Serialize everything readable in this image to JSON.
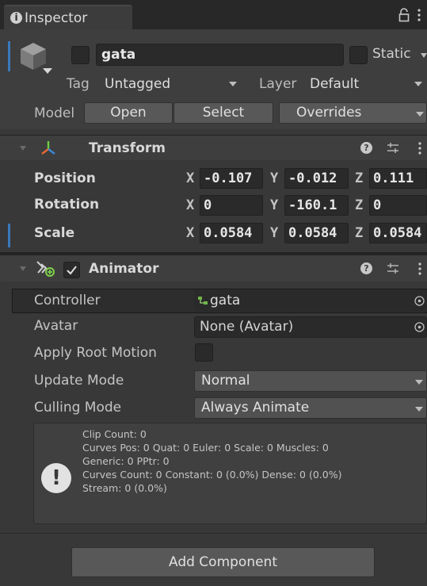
{
  "tab": {
    "icon": "info-icon",
    "label": "Inspector"
  },
  "window_icons": [
    "lock-icon",
    "kebab-menu-icon"
  ],
  "object": {
    "name": "gata",
    "static_label": "Static",
    "tag_label": "Tag",
    "tag_value": "Untagged",
    "layer_label": "Layer",
    "layer_value": "Default",
    "model_label": "Model",
    "open_label": "Open",
    "select_label": "Select",
    "overrides_label": "Overrides"
  },
  "transform": {
    "title": "Transform",
    "rows": [
      {
        "label": "Position",
        "x": "-0.107",
        "y": "-0.012",
        "z": "0.111"
      },
      {
        "label": "Rotation",
        "x": "0",
        "y": "-160.1",
        "z": "0"
      },
      {
        "label": "Scale",
        "x": "0.0584",
        "y": "0.0584",
        "z": "0.0584"
      }
    ],
    "axis_x": "X",
    "axis_y": "Y",
    "axis_z": "Z"
  },
  "animator": {
    "title": "Animator",
    "controller_label": "Controller",
    "controller_value": "gata",
    "avatar_label": "Avatar",
    "avatar_value": "None (Avatar)",
    "apply_root_motion_label": "Apply Root Motion",
    "update_mode_label": "Update Mode",
    "update_mode_value": "Normal",
    "culling_mode_label": "Culling Mode",
    "culling_mode_value": "Always Animate",
    "info": [
      "Clip Count: 0",
      "Curves Pos: 0 Quat: 0 Euler: 0 Scale: 0 Muscles: 0",
      "Generic: 0 PPtr: 0",
      "Curves Count: 0 Constant: 0 (0.0%) Dense: 0 (0.0%)",
      "Stream: 0 (0.0%)"
    ]
  },
  "add_component_label": "Add Component",
  "colors": {
    "background": "#383838",
    "header": "#3e3e3e",
    "field": "#2a2a2a",
    "tab_active": "#3c3c3c",
    "selection_accent": "#3a79bb"
  }
}
